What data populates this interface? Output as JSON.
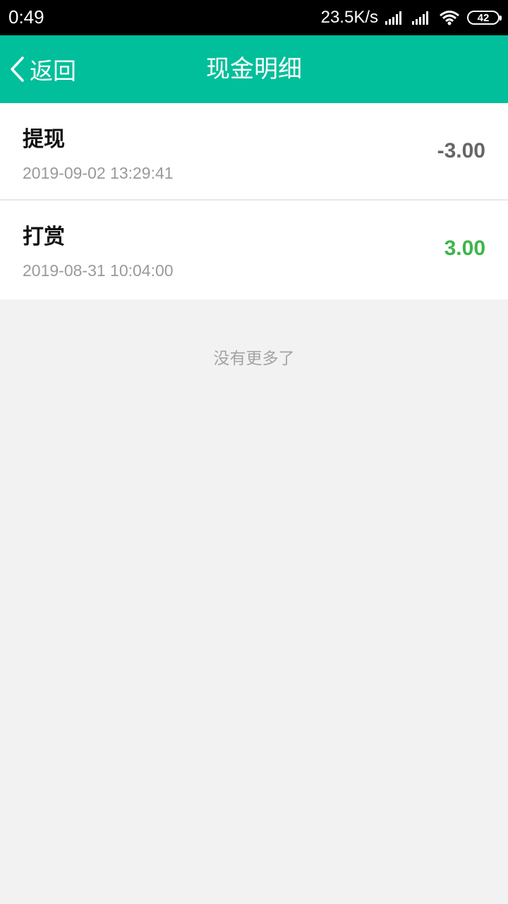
{
  "status_bar": {
    "time": "0:49",
    "net_speed": "23.5K/s",
    "battery": "42"
  },
  "nav": {
    "back_label": "返回",
    "title": "现金明细",
    "background": "#00bf9a"
  },
  "records": [
    {
      "title": "提现",
      "time": "2019-09-02 13:29:41",
      "amount": "-3.00",
      "amount_color": "#666666"
    },
    {
      "title": "打赏",
      "time": "2019-08-31 10:04:00",
      "amount": "3.00",
      "amount_color": "#3cb54a"
    }
  ],
  "footer": {
    "no_more": "没有更多了"
  }
}
